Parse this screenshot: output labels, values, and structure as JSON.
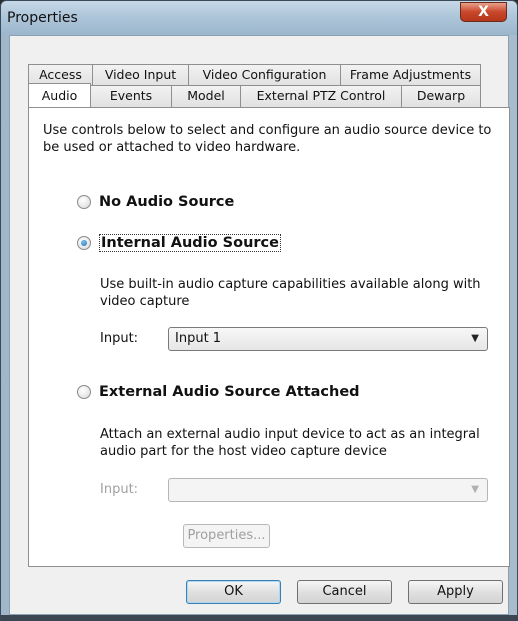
{
  "window": {
    "title": "Properties",
    "close_label": "X"
  },
  "tabs": {
    "back_row": [
      "Access",
      "Video Input",
      "Video Configuration",
      "Frame Adjustments"
    ],
    "front_row": [
      "Audio",
      "Events",
      "Model",
      "External PTZ Control",
      "Dewarp"
    ],
    "selected": "Audio"
  },
  "audio": {
    "description": "Use controls below to select and configure an audio source device to be used or attached to video hardware.",
    "no_audio": {
      "label": "No Audio Source",
      "selected": false
    },
    "internal": {
      "label": "Internal Audio Source",
      "selected": true,
      "help": "Use built-in audio capture capabilities available along with video capture",
      "input_label": "Input:",
      "input_value": "Input 1"
    },
    "external": {
      "label": "External Audio Source Attached",
      "selected": false,
      "help": "Attach an external audio input device to act as an integral audio part for the host video capture device",
      "input_label": "Input:",
      "input_value": "",
      "properties_button": "Properties..."
    }
  },
  "buttons": {
    "ok": "OK",
    "cancel": "Cancel",
    "apply": "Apply"
  }
}
